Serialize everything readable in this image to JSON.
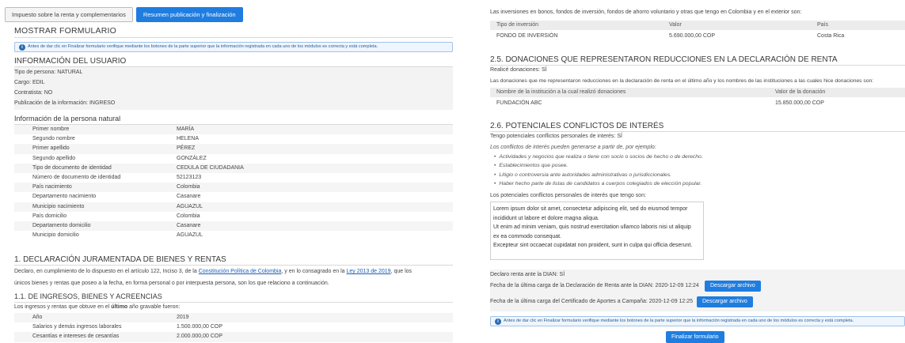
{
  "tabs": [
    {
      "label": "Impuesto sobre la renta y complementarios"
    },
    {
      "label": "Resumen publicación y finalización"
    }
  ],
  "left": {
    "title": "MOSTRAR FORMULARIO",
    "notice": "Antes de dar clic en Finalizar formulario verifique mediante los botones de la parte superior que la información registrada en cada uno de los módulos es correcta y está completa.",
    "user_info": {
      "heading": "INFORMACIÓN DEL USUARIO",
      "lines": [
        "Tipo de persona: NATURAL",
        "Cargo: EDIL",
        "Contratista: NO",
        "Publicación de la información: INGRESO"
      ]
    },
    "natural_person": {
      "heading": "Información de la persona natural",
      "fields": [
        {
          "label": "Primer nombre",
          "value": "MARÍA"
        },
        {
          "label": "Segundo nombre",
          "value": "HELENA"
        },
        {
          "label": "Primer apellido",
          "value": "PÉREZ"
        },
        {
          "label": "Segundo apellido",
          "value": "GONZÁLEZ"
        },
        {
          "label": "Tipo de documento de identidad",
          "value": "CEDULA DE CIUDADANIA"
        },
        {
          "label": "Número de documento de identidad",
          "value": "52123123"
        },
        {
          "label": "País nacimiento",
          "value": "Colombia"
        },
        {
          "label": "Departamento nacimiento",
          "value": "Casanare"
        },
        {
          "label": "Municipio nacimiento",
          "value": "AGUAZUL"
        },
        {
          "label": "País domicilio",
          "value": "Colombia"
        },
        {
          "label": "Departamento domicilio",
          "value": "Casanare"
        },
        {
          "label": "Municipio domicilio",
          "value": "AGUAZUL"
        }
      ]
    },
    "declaration": {
      "heading": "1. DECLARACIÓN JURAMENTADA DE BIENES Y RENTAS",
      "text_a": "Declaro, en cumplimiento de lo dispuesto en el artículo 122, Inciso 3, de la ",
      "link_a": "Constitución Política de Colombia",
      "text_b": ", y en lo consagrado en la ",
      "link_b": "Ley 2013 de 2019",
      "text_c": ", que los",
      "text_d": "únicos bienes y rentas que poseo a la fecha, en forma personal o por interpuesta persona, son los que relaciono a continuación."
    },
    "income": {
      "heading": "1.1. DE INGRESOS, BIENES Y ACREENCIAS",
      "intro_a": "Los ingresos y rentas que obtuve en el ",
      "intro_bold": "último",
      "intro_b": " año gravable fueron:",
      "rows": [
        {
          "label": "Año",
          "value": "2019"
        },
        {
          "label": "Salarios y demás ingresos laborales",
          "value": "1.500.000,00 COP"
        },
        {
          "label": "Cesantías e intereses de cesantías",
          "value": "2.000.000,00 COP"
        }
      ]
    }
  },
  "right": {
    "investments_intro": "Las inversiones en bonos, fondos de inversión, fondos de ahorro voluntario y otras que tengo en Colombia y en el exterior son:",
    "investments_table": {
      "headers": [
        "Tipo de inversión",
        "Valor",
        "País"
      ],
      "rows": [
        [
          "FONDO DE INVERSIÓN",
          "5.690.000,00 COP",
          "Costa Rica"
        ]
      ]
    },
    "donations": {
      "heading": "2.5. DONACIONES QUE REPRESENTARON REDUCCIONES EN LA DECLARACIÓN DE RENTA",
      "made": "Realicé donaciones: SÍ",
      "intro": "Las donaciones que me representaron reducciones en la declaración de renta en el último año y los nombres de las instituciones a las cuales hice donaciones son:",
      "headers": [
        "Nombre de la institución a la cual realizó donaciones",
        "Valor de la donación"
      ],
      "rows": [
        [
          "FUNDACIÓN ABC",
          "15.850.000,00 COP"
        ]
      ]
    },
    "conflicts": {
      "heading": "2.6. POTENCIALES CONFLICTOS DE INTERÉS",
      "has": "Tengo potenciales conflictos personales de interés: SÍ",
      "intro": "Los conflictos de interés pueden generarse a partir de, por ejemplo:",
      "examples": [
        "Actividades y negocios que realiza o tiene con socio o socios de hecho o de derecho.",
        "Establecimientos que posee.",
        "Litigio o controversia ante autoridades administrativas o jurisdiccionales.",
        "Haber hecho parte de listas de candidatos a cuerpos colegiados de elección popular."
      ],
      "textarea_label": "Los potenciales conflictos personales de interés que tengo son:",
      "textarea_lines": [
        "Lorem ipsum dolor sit amet, consectetur adipiscing elit, sed do eiusmod tempor",
        "incididunt ut labore et dolore magna aliqua.",
        "Ut enim ad minim veniam, quis nostrud exercitation ullamco laboris nisi ut aliquip",
        "ex ea commodo consequat.",
        "Excepteur sint occaecat cupidatat non proident, sunt in culpa qui officia deserunt."
      ]
    },
    "dian": {
      "declares": "Declaro renta ante la DIAN: SÍ",
      "renta_upload": "Fecha de la última carga de la Declaración de Renta ante la DIAN: 2020-12-09 12:24",
      "aportes_upload": "Fecha de la última carga del Certificado de Aportes a Campaña: 2020-12-09 12:25",
      "download_label": "Descargar archivo"
    },
    "notice": "Antes de dar clic en Finalizar formulario verifique mediante los botones de la parte superior que la información registrada en cada uno de los módulos es correcta y está completa.",
    "finalize_label": "Finalizar formulario"
  }
}
